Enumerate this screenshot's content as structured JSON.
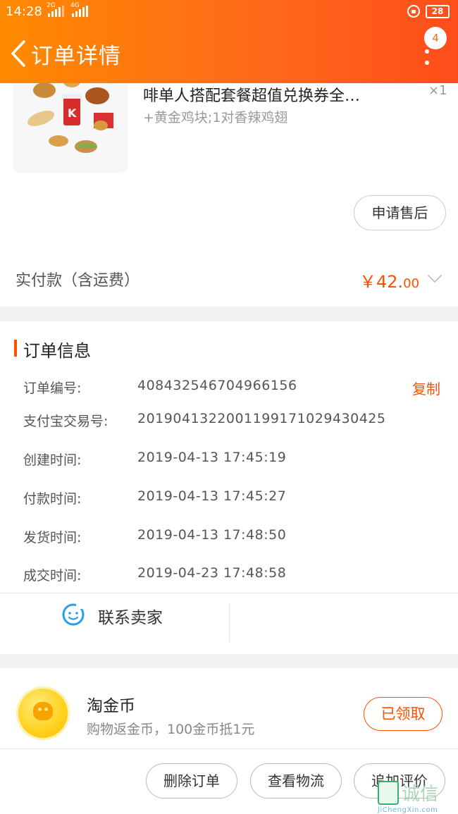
{
  "status_bar": {
    "time": "14:28",
    "net1": "2G",
    "net2": "4G",
    "battery": "28"
  },
  "header": {
    "title": "订单详情",
    "badge_count": "4",
    "accent": "#ff6a1a"
  },
  "product": {
    "name": "啡单人搭配套餐超值兑换券全…",
    "spec": "+黄金鸡块;1对香辣鸡翅",
    "qty": "×1",
    "aftersale_label": "申请售后"
  },
  "payment": {
    "label": "实付款（含运费）",
    "amount_main": "￥42.",
    "amount_cents": "00"
  },
  "order_info": {
    "title": "订单信息",
    "copy_label": "复制",
    "rows": [
      {
        "label": "订单编号:",
        "value": "408432546704966156"
      },
      {
        "label": "支付宝交易号:",
        "value": "2019041322001199171029430425"
      },
      {
        "label": "创建时间:",
        "value": "2019-04-13 17:45:19"
      },
      {
        "label": "付款时间:",
        "value": "2019-04-13 17:45:27"
      },
      {
        "label": "发货时间:",
        "value": "2019-04-13 17:48:50"
      },
      {
        "label": "成交时间:",
        "value": "2019-04-23 17:48:58"
      }
    ],
    "contact_label": "联系卖家"
  },
  "coins": {
    "title": "淘金币",
    "desc": "购物返金币，100金币抵1元",
    "claimed_label": "已领取"
  },
  "actions": {
    "delete": "删除订单",
    "logistics": "查看物流",
    "review": "追加评价"
  },
  "watermark": {
    "text": "诚信",
    "sub": "JiChengXin.com"
  }
}
